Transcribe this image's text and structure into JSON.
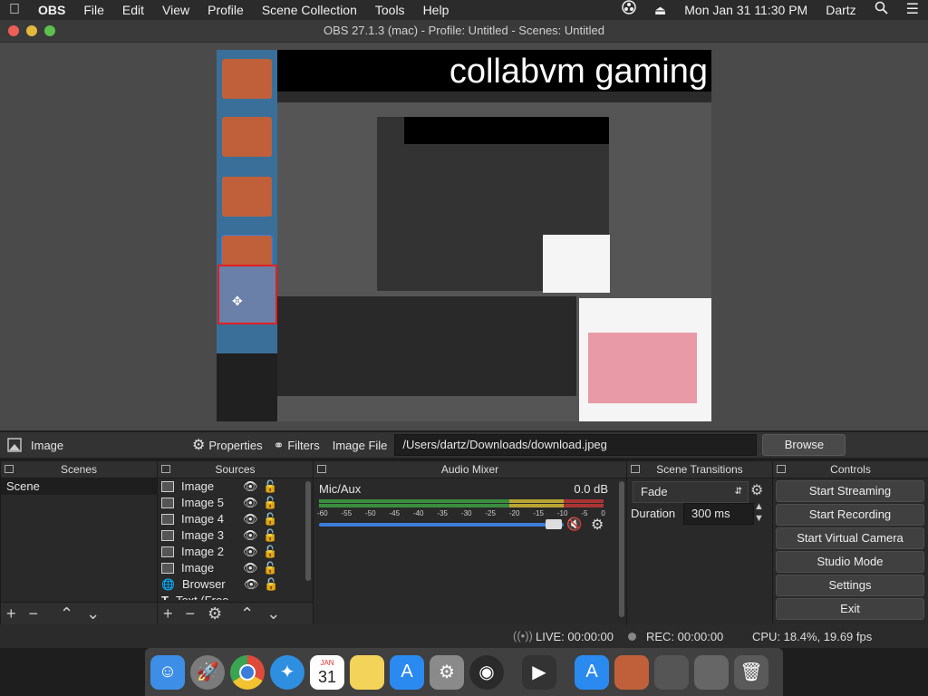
{
  "menubar": {
    "apple": "",
    "app": "OBS",
    "items": [
      "File",
      "Edit",
      "View",
      "Profile",
      "Scene Collection",
      "Tools",
      "Help"
    ],
    "clock": "Mon Jan 31  11:30 PM",
    "user": "Dartz"
  },
  "window": {
    "title": "OBS 27.1.3 (mac) - Profile: Untitled - Scenes: Untitled"
  },
  "preview": {
    "overlay_text": "collabvm gaming"
  },
  "toolbar": {
    "source_name": "Image",
    "properties": "Properties",
    "filters": "Filters",
    "image_file_label": "Image File",
    "path": "/Users/dartz/Downloads/download.jpeg",
    "browse": "Browse"
  },
  "scenes": {
    "title": "Scenes",
    "items": [
      "Scene"
    ]
  },
  "sources": {
    "title": "Sources",
    "items": [
      "Image",
      "Image 5",
      "Image 4",
      "Image 3",
      "Image 2",
      "Image",
      "Browser",
      "Text (Free"
    ]
  },
  "mixer": {
    "title": "Audio Mixer",
    "channel": "Mic/Aux",
    "level": "0.0 dB",
    "ticks": [
      "-60",
      "-55",
      "-50",
      "-45",
      "-40",
      "-35",
      "-30",
      "-25",
      "-20",
      "-15",
      "-10",
      "-5",
      "0"
    ]
  },
  "transitions": {
    "title": "Scene Transitions",
    "type": "Fade",
    "duration_label": "Duration",
    "duration": "300 ms"
  },
  "controls": {
    "title": "Controls",
    "buttons": [
      "Start Streaming",
      "Start Recording",
      "Start Virtual Camera",
      "Studio Mode",
      "Settings",
      "Exit"
    ]
  },
  "status": {
    "live": "LIVE: 00:00:00",
    "rec": "REC: 00:00:00",
    "cpu": "CPU: 18.4%, 19.69 fps"
  },
  "calendar": {
    "month": "JAN",
    "day": "31"
  },
  "colors": {
    "accent_blue": "#3b7dd8",
    "meter_green": "#4caf50",
    "meter_yellow": "#c9b23a",
    "meter_red": "#c03a3a",
    "mute_red": "#e03030"
  }
}
